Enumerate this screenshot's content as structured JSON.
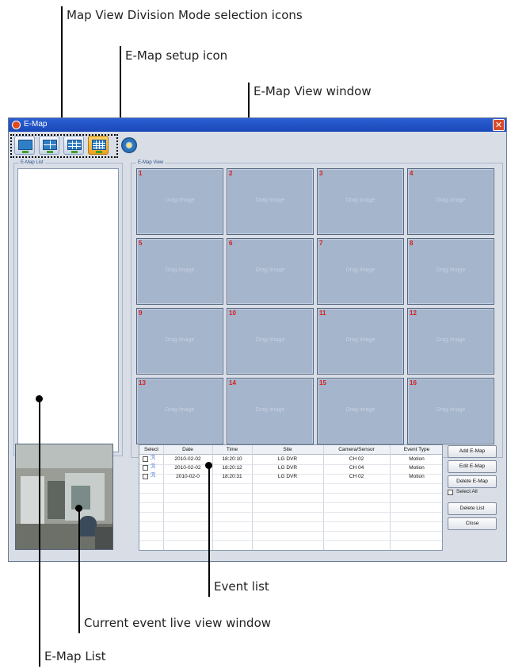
{
  "annotations": {
    "map_view_division": "Map View Division Mode selection icons",
    "emap_setup": "E-Map setup icon",
    "emap_view_window": "E-Map View window",
    "event_list": "Event list",
    "live_view": "Current event live view window",
    "emap_list": "E-Map List"
  },
  "window": {
    "title": "E-Map",
    "close_glyph": "✕"
  },
  "toolbar": {
    "mode_icons": [
      "1-division-icon",
      "4-division-icon",
      "9-division-icon",
      "16-division-icon"
    ],
    "active_mode": "16-division",
    "setup_icon": "emap-setup-icon"
  },
  "emap_list": {
    "label": "E-Map List"
  },
  "emap_view": {
    "label": "E-Map View",
    "cells": [
      {
        "num": "1",
        "text": "Drag Image"
      },
      {
        "num": "2",
        "text": "Drag Image"
      },
      {
        "num": "3",
        "text": "Drag Image"
      },
      {
        "num": "4",
        "text": "Drag Image"
      },
      {
        "num": "5",
        "text": "Drag Image"
      },
      {
        "num": "6",
        "text": "Drag Image"
      },
      {
        "num": "7",
        "text": "Drag Image"
      },
      {
        "num": "8",
        "text": "Drag Image"
      },
      {
        "num": "9",
        "text": "Drag Image"
      },
      {
        "num": "10",
        "text": "Drag Image"
      },
      {
        "num": "11",
        "text": "Drag Image"
      },
      {
        "num": "12",
        "text": "Drag Image"
      },
      {
        "num": "13",
        "text": "Drag Image"
      },
      {
        "num": "14",
        "text": "Drag Image"
      },
      {
        "num": "15",
        "text": "Drag Image"
      },
      {
        "num": "16",
        "text": "Drag Image"
      }
    ]
  },
  "event_list": {
    "columns": [
      "Select",
      "Date",
      "Time",
      "Site",
      "Camera/Sensor",
      "Event Type"
    ],
    "rows": [
      {
        "date": "2010-02-02",
        "time": "18:20:10",
        "site": "LG DVR",
        "camera": "CH 02",
        "type": "Motion"
      },
      {
        "date": "2010-02-02",
        "time": "18:20:12",
        "site": "LG DVR",
        "camera": "CH 04",
        "type": "Motion"
      },
      {
        "date": "2010-02-0",
        "time": "18:20:31",
        "site": "LG DVR",
        "camera": "CH 02",
        "type": "Motion"
      }
    ]
  },
  "buttons": {
    "add": "Add E-Map",
    "edit": "Edit E-Map",
    "delete": "Delete E-Map",
    "select_all": "Select All",
    "delete_list": "Delete List",
    "close": "Close"
  },
  "colors": {
    "titlebar": "#2b5fd3",
    "cell_bg": "#a5b5cc",
    "cell_number": "#d81e1e",
    "active_mode": "#e8a11c"
  }
}
